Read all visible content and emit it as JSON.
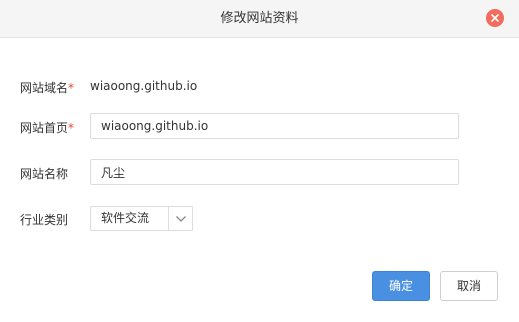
{
  "dialog": {
    "title": "修改网站资料",
    "close_icon": "close-icon"
  },
  "form": {
    "domain": {
      "label": "网站域名",
      "required_mark": "*",
      "value": "wiaoong.github.io"
    },
    "homepage": {
      "label": "网站首页",
      "required_mark": "*",
      "value": "wiaoong.github.io"
    },
    "site_name": {
      "label": "网站名称",
      "value": "凡尘"
    },
    "industry": {
      "label": "行业类别",
      "selected": "软件交流",
      "arrow_icon": "chevron-down-icon"
    }
  },
  "actions": {
    "confirm_label": "确定",
    "cancel_label": "取消"
  },
  "colors": {
    "accent": "#4a90e2",
    "close": "#f16c5c",
    "required": "#e8423c"
  }
}
